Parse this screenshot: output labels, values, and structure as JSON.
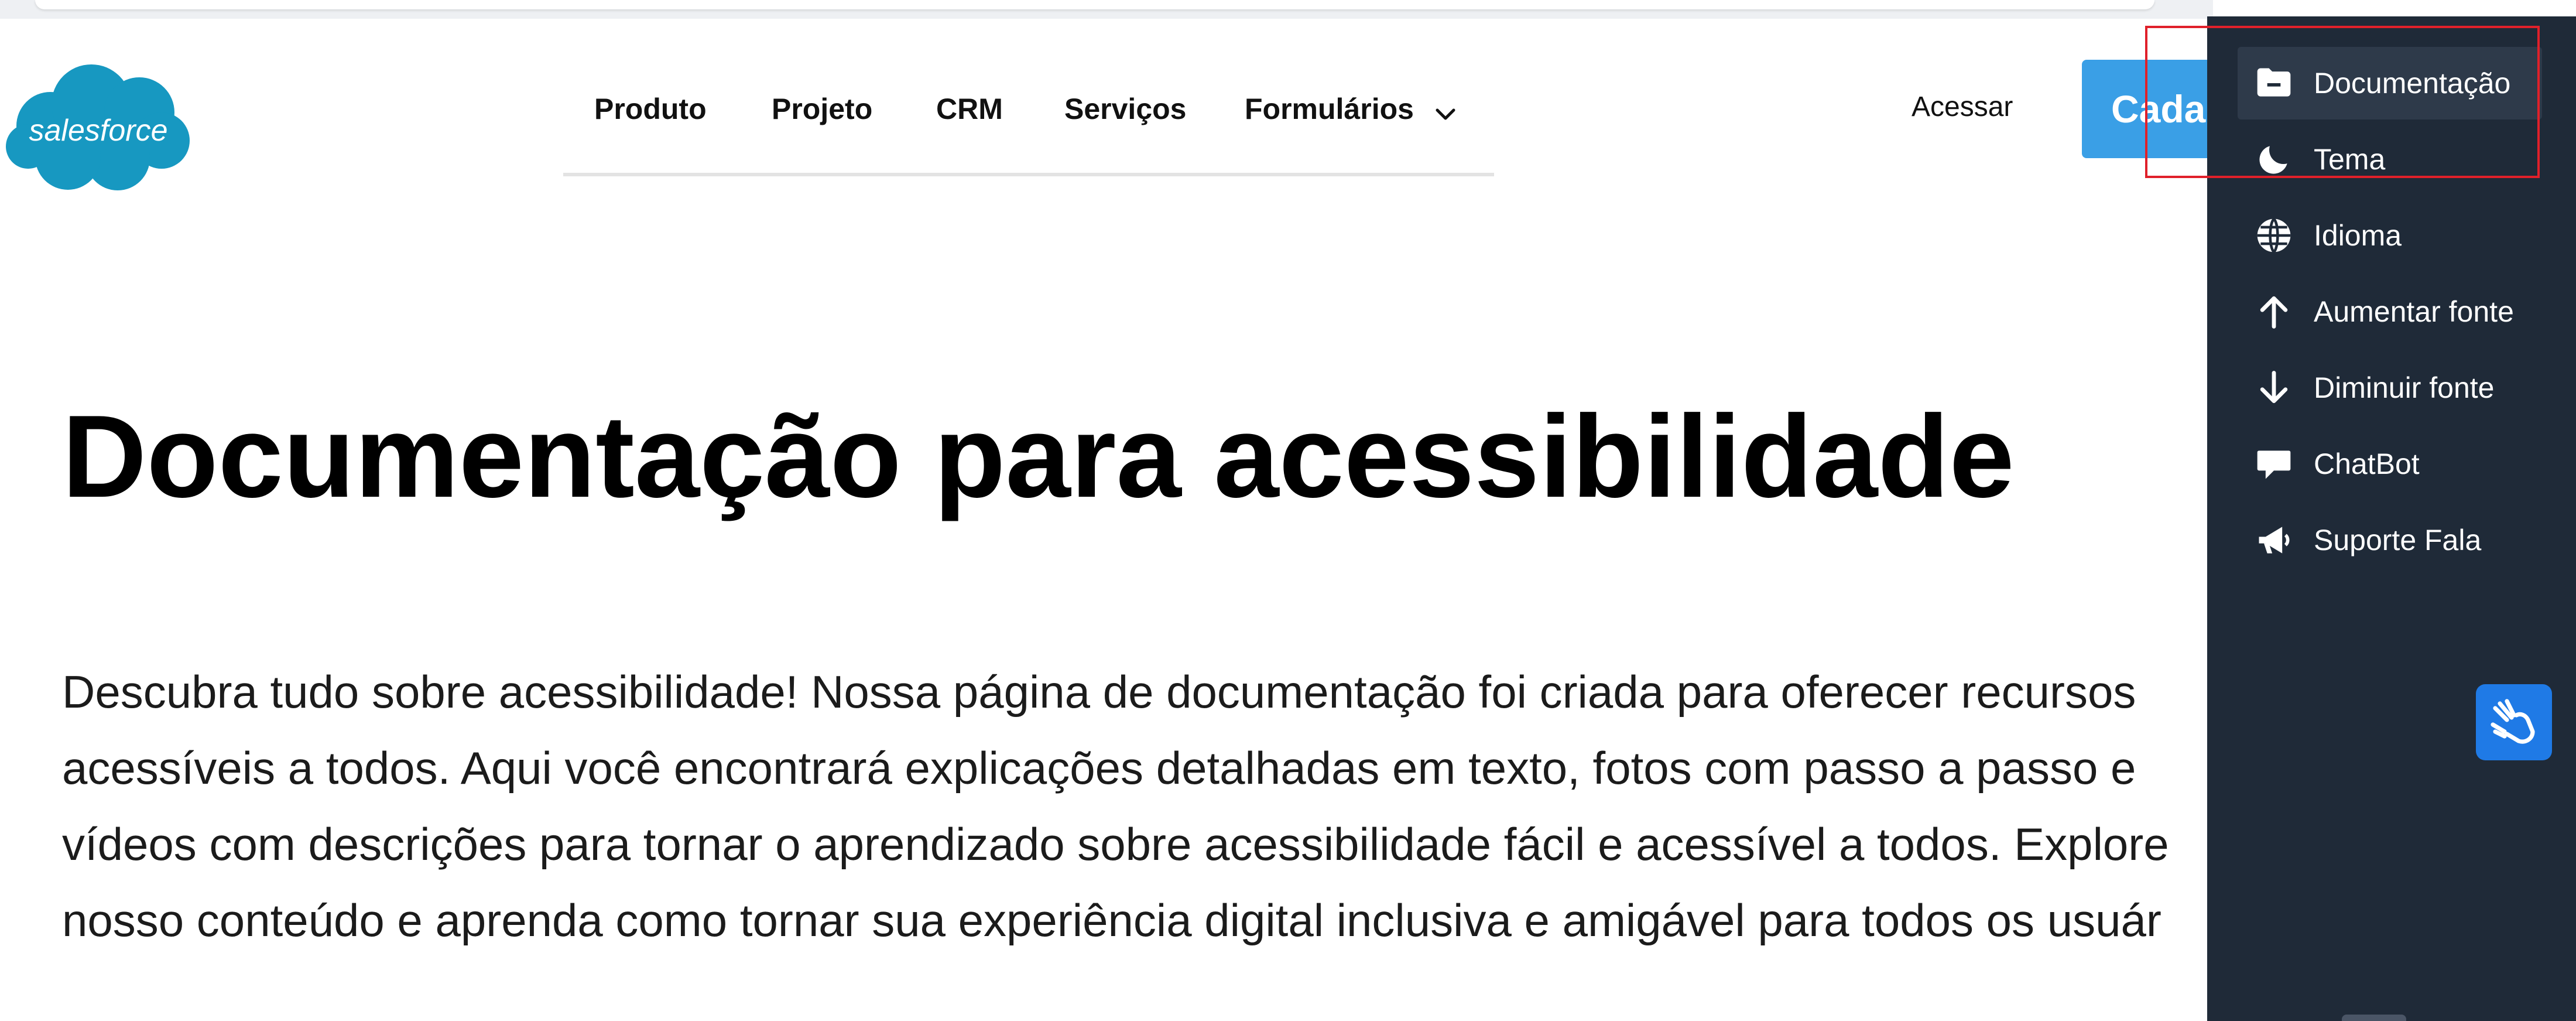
{
  "brand": {
    "name": "salesforce",
    "color": "#1798c1"
  },
  "nav": {
    "items": [
      {
        "label": "Produto"
      },
      {
        "label": "Projeto"
      },
      {
        "label": "CRM"
      },
      {
        "label": "Serviços"
      },
      {
        "label": "Formulários",
        "has_dropdown": true
      }
    ]
  },
  "header": {
    "login_label": "Acessar",
    "signup_label": "Cada"
  },
  "main": {
    "title": "Documentação para acessibilidade",
    "description": "Descubra tudo sobre acessibilidade! Nossa página de documentação foi criada para oferecer recursos acessíveis a todos. Aqui você encontrará explicações detalhadas em texto, fotos com passo a passo e vídeos com descrições para tornar o aprendizado sobre acessibilidade fácil e acessível a todos. Explore nosso conteúdo e aprenda como tornar sua experiência digital inclusiva e amigável para todos os usuár"
  },
  "accessibility_panel": {
    "items": [
      {
        "label": "Documentação",
        "icon": "folder-icon",
        "active": true
      },
      {
        "label": "Tema",
        "icon": "moon-icon"
      },
      {
        "label": "Idioma",
        "icon": "globe-icon"
      },
      {
        "label": "Aumentar fonte",
        "icon": "arrow-up-icon"
      },
      {
        "label": "Diminuir fonte",
        "icon": "arrow-down-icon"
      },
      {
        "label": "ChatBot",
        "icon": "chat-bubble-icon"
      },
      {
        "label": "Suporte Fala",
        "icon": "megaphone-icon"
      }
    ],
    "background": "#1f2a38",
    "sign_language_button_icon": "sign-language-hands-icon",
    "sign_language_button_color": "#1f7ae6"
  },
  "colors": {
    "accent": "#3a9fe6",
    "highlight": "#e0202a"
  }
}
